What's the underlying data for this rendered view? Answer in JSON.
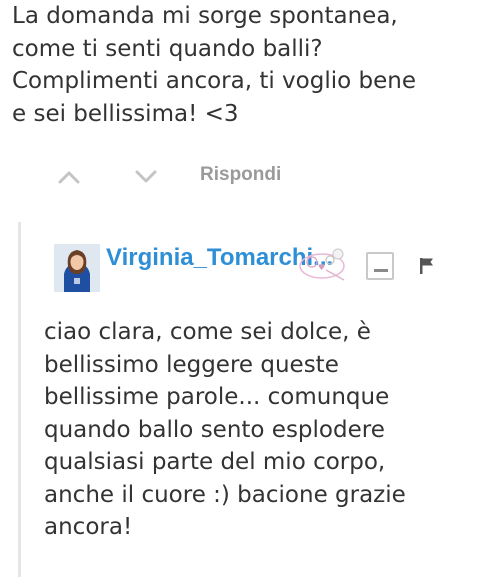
{
  "comment": {
    "lines": [
      "La domanda mi sorge spontanea,",
      "come ti senti quando balli?",
      "Complimenti ancora, ti voglio bene",
      "e sei bellissima! <3"
    ],
    "actions": {
      "upvote_icon": "chevron-up-icon",
      "downvote_icon": "chevron-down-icon",
      "reply_label": "Rispondi"
    }
  },
  "reply": {
    "username": "Virginia_Tomarchi...",
    "avatar_icon": "user-avatar",
    "collapse_icon": "minus-icon",
    "flag_icon": "flag-icon",
    "lines": [
      "ciao clara, come sei dolce, è",
      "bellissimo leggere queste",
      "bellissime parole... comunque",
      "quando ballo sento esplodere",
      "qualsiasi parte del mio corpo,",
      "anche il cuore :) bacione grazie",
      "ancora!"
    ]
  },
  "colors": {
    "text": "#333333",
    "username": "#2f8fd6",
    "muted": "#9a9a9a",
    "thread_line": "#e6e6e6"
  }
}
